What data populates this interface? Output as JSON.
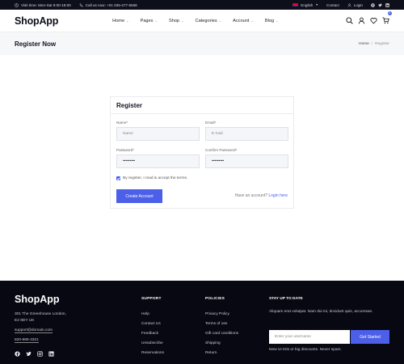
{
  "topbar": {
    "hours": "Visit time: Mon-Sat 8:00-18:00",
    "phone": "Call us now: +01 035-477-5568",
    "language": "English",
    "contact": "Contact",
    "login": "Login"
  },
  "header": {
    "logo": "ShopApp",
    "nav": [
      {
        "label": "Home"
      },
      {
        "label": "Pages"
      },
      {
        "label": "Shop"
      },
      {
        "label": "Categories"
      },
      {
        "label": "Account"
      },
      {
        "label": "Blog"
      }
    ],
    "cart_count": "0"
  },
  "titleband": {
    "title": "Register Now",
    "breadcrumb": {
      "home": "Home",
      "sep": "/",
      "current": "Register"
    }
  },
  "form": {
    "title": "Register",
    "name_label": "Name*",
    "name_placeholder": "Name",
    "email_label": "Email*",
    "email_placeholder": "E-mail",
    "password_label": "Password*",
    "password_value": "•••••••••",
    "confirm_label": "Confirm Password*",
    "confirm_value": "•••••••••",
    "terms_text": "By register, I read & accept the terms.",
    "terms_checked": true,
    "submit_label": "Create Account",
    "have_account": "Have an account?",
    "login_link": "Login here"
  },
  "footer": {
    "logo": "ShopApp",
    "address_line1": "301 The Greenhouse London,",
    "address_line2": "E2 8DY UK",
    "email": "support@domain.com",
    "phone": "820-885-3321",
    "support": {
      "title": "SUPPORT",
      "links": [
        "Help",
        "Contact Us",
        "Feedback",
        "Unsubscribe",
        "Reservations"
      ]
    },
    "policies": {
      "title": "POLICIES",
      "links": [
        "Privacy Policy",
        "Terms of use",
        "Gift card conditions",
        "Shipping",
        "Return"
      ]
    },
    "newsletter": {
      "title": "STAY UP TO DATE",
      "text": "Aliquam erat volutpat. Nam dui mi, tincidunt quis, accumsan.",
      "placeholder": "Enter your username",
      "button": "Get Started",
      "note": "New UI Kits or big discounts. Never spam."
    }
  },
  "colors": {
    "accent": "#4c5fe8",
    "dark": "#070811",
    "topbar": "#0d0f1a"
  }
}
